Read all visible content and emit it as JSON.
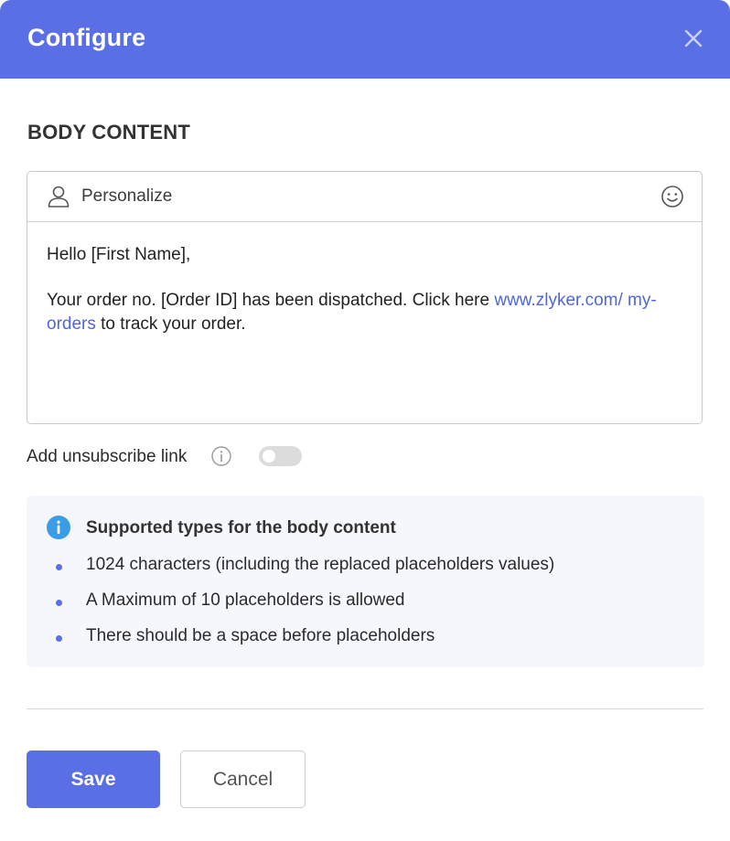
{
  "header": {
    "title": "Configure",
    "close_icon": "close-icon",
    "background_color": "#5a6fe6"
  },
  "section": {
    "title": "BODY CONTENT"
  },
  "editor": {
    "toolbar": {
      "personalize_label": "Personalize",
      "personalize_icon": "person-icon",
      "emoji_icon": "smiley-icon"
    },
    "body": {
      "greeting": "Hello [First Name],",
      "line_prefix": "Your order no. [Order ID] has been dispatched. Click here ",
      "link_text": "www.zlyker.com/ my-orders",
      "line_suffix": " to track your order.",
      "link_color": "#4f67d8"
    }
  },
  "unsubscribe": {
    "label": "Add unsubscribe link",
    "info_icon": "info-outline-icon",
    "enabled": false
  },
  "info_box": {
    "icon": "info-filled-icon",
    "title": "Supported types for the body content",
    "items": [
      "1024 characters (including the replaced placeholders values)",
      "A Maximum of 10 placeholders is allowed",
      "There should be a space before placeholders"
    ]
  },
  "footer": {
    "save_label": "Save",
    "cancel_label": "Cancel",
    "accent_color": "#5a6fe6"
  }
}
